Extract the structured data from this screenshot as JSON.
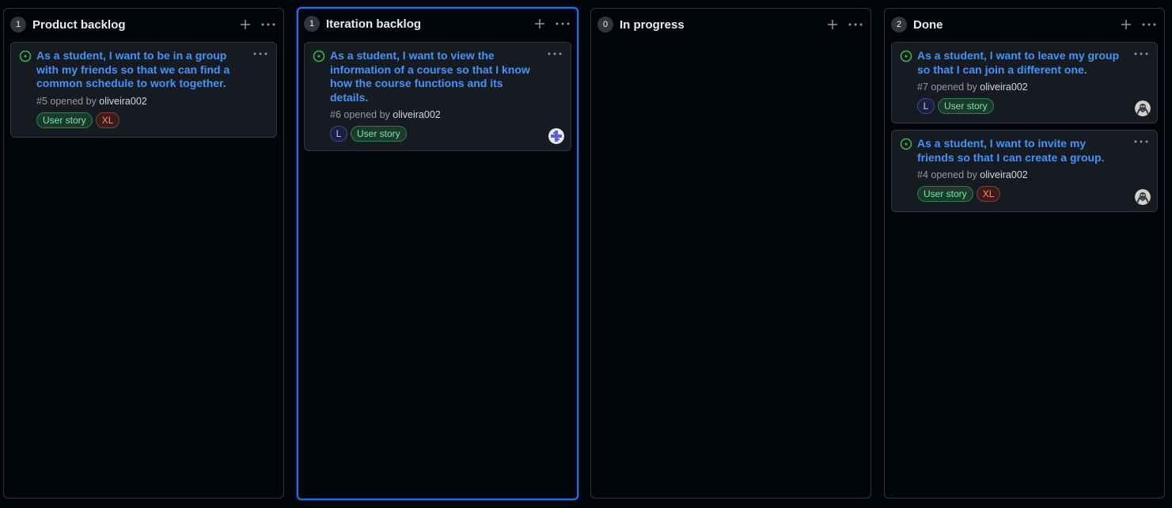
{
  "colors": {
    "background": "#010409",
    "card": "#161b22",
    "border": "#30363d",
    "link": "#4493f8",
    "open_icon": "#3fb950",
    "selected_border": "#1f6feb"
  },
  "columns": [
    {
      "title": "Product backlog",
      "count": "1",
      "cards": [
        {
          "title": "As a student, I want to be in a group with my friends so that we can find a common schedule to work together.",
          "number": "#5",
          "opened_by": "opened by",
          "author": "oliveira002",
          "labels": [
            "User story",
            "XL"
          ]
        }
      ]
    },
    {
      "title": "Iteration backlog",
      "count": "1",
      "cards": [
        {
          "title": "As a student, I want to view the information of a course so that I know how the course functions and its details.",
          "number": "#6",
          "opened_by": "opened by",
          "author": "oliveira002",
          "size": "L",
          "labels": [
            "User story"
          ],
          "avatar": "identicon-avatar"
        }
      ]
    },
    {
      "title": "In progress",
      "count": "0",
      "cards": []
    },
    {
      "title": "Done",
      "count": "2",
      "cards": [
        {
          "title": "As a student, I want to leave my group so that I can join a different one.",
          "number": "#7",
          "opened_by": "opened by",
          "author": "oliveira002",
          "size": "L",
          "labels": [
            "User story"
          ],
          "avatar": "user-avatar"
        },
        {
          "title": "As a student, I want to invite my friends so that I can create a group.",
          "number": "#4",
          "opened_by": "opened by",
          "author": "oliveira002",
          "labels": [
            "User story",
            "XL"
          ],
          "avatar": "user-avatar"
        }
      ]
    }
  ]
}
